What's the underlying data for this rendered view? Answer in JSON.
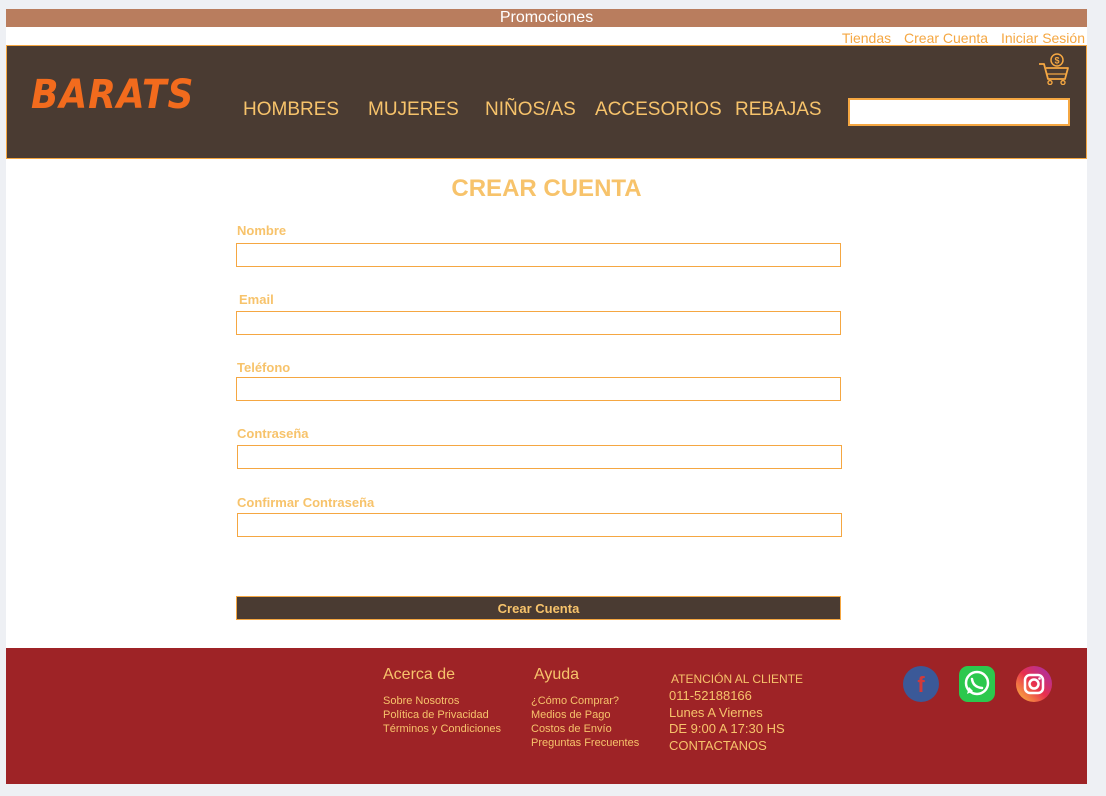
{
  "promo": {
    "label": "Promociones"
  },
  "top_links": [
    "Tiendas",
    "Crear Cuenta",
    "Iniciar Sesión"
  ],
  "brand": {
    "logo": "BARATS"
  },
  "nav": [
    "HOMBRES",
    "MUJERES",
    "NIÑOS/AS",
    "ACCESORIOS",
    "REBAJAS"
  ],
  "search": {
    "placeholder": ""
  },
  "cart_icon": "shopping-cart-icon",
  "form": {
    "title": "CREAR CUENTA",
    "fields": [
      {
        "label": "Nombre",
        "value": ""
      },
      {
        "label": "Email",
        "value": ""
      },
      {
        "label": "Teléfono",
        "value": ""
      },
      {
        "label": "Contraseña",
        "value": ""
      },
      {
        "label": "Confirmar Contraseña",
        "value": ""
      }
    ],
    "submit_label": "Crear Cuenta"
  },
  "footer": {
    "about": {
      "heading": "Acerca de",
      "links": [
        "Sobre Nosotros",
        "Política de Privacidad",
        "Términos y Condiciones"
      ]
    },
    "help": {
      "heading": "Ayuda",
      "links": [
        "¿Cómo Comprar?",
        "Medios de Pago",
        "Costos de Envío",
        "Preguntas Frecuentes"
      ]
    },
    "contact": {
      "heading": "ATENCIÓN AL CLIENTE",
      "phone": "011-52188166",
      "days": "Lunes A Viernes",
      "hours": "DE 9:00 A 17:30 HS",
      "cta": "CONTACTANOS"
    },
    "social_icons": [
      "facebook-icon",
      "whatsapp-icon",
      "instagram-icon"
    ]
  },
  "colors": {
    "accent": "#f5a742",
    "text_gold": "#f7c36b",
    "header_bg": "#4a3b32",
    "promo_bg": "#b97d5e",
    "footer_bg": "#9e2326",
    "logo": "#f26b1d"
  }
}
